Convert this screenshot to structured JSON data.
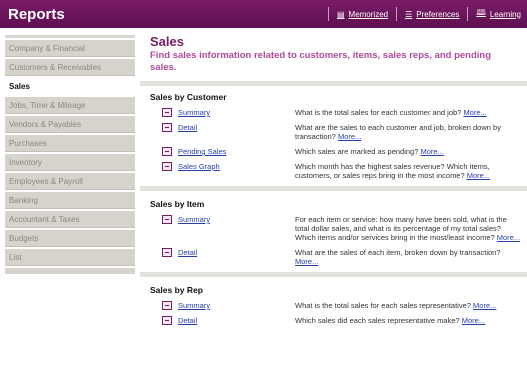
{
  "window": {
    "title": "Reports"
  },
  "toolbar": {
    "memorized": "Memorized",
    "preferences": "Preferences",
    "learning": "Learning"
  },
  "sidebar": {
    "items": [
      {
        "label": "Company & Financial"
      },
      {
        "label": "Customers & Receivables"
      },
      {
        "label": "Sales",
        "active": true
      },
      {
        "label": "Jobs, Time & Mileage"
      },
      {
        "label": "Vendors & Payables"
      },
      {
        "label": "Purchases"
      },
      {
        "label": "Inventory"
      },
      {
        "label": "Employees & Payroll"
      },
      {
        "label": "Banking"
      },
      {
        "label": "Accountant & Taxes"
      },
      {
        "label": "Budgets"
      },
      {
        "label": "List"
      }
    ]
  },
  "main": {
    "title": "Sales",
    "subtitle": "Find sales information related to customers, items, sales reps, and pending sales.",
    "more_label": "More...",
    "sections": [
      {
        "title": "Sales by Customer",
        "reports": [
          {
            "name": "Summary",
            "desc": "What is the total sales for each customer and job?"
          },
          {
            "name": "Detail",
            "desc": "What are the sales to each customer and job, broken down by transaction?"
          },
          {
            "name": "Pending Sales",
            "desc": "Which sales are marked as pending?"
          },
          {
            "name": "Sales Graph",
            "desc": "Which month has the highest sales revenue? Which items, customers, or sales reps bring in the most income?"
          }
        ]
      },
      {
        "title": "Sales by Item",
        "reports": [
          {
            "name": "Summary",
            "desc": "For each item or service: how many have been sold, what is the total dollar sales, and what is its percentage of my total sales? Which items and/or services bring in the most/least income?"
          },
          {
            "name": "Detail",
            "desc": "What are the sales of each item, broken down by transaction?"
          }
        ]
      },
      {
        "title": "Sales by Rep",
        "reports": [
          {
            "name": "Summary",
            "desc": "What is the total sales for each sales representative?"
          },
          {
            "name": "Detail",
            "desc": "Which sales did each sales representative make?"
          }
        ]
      }
    ]
  }
}
